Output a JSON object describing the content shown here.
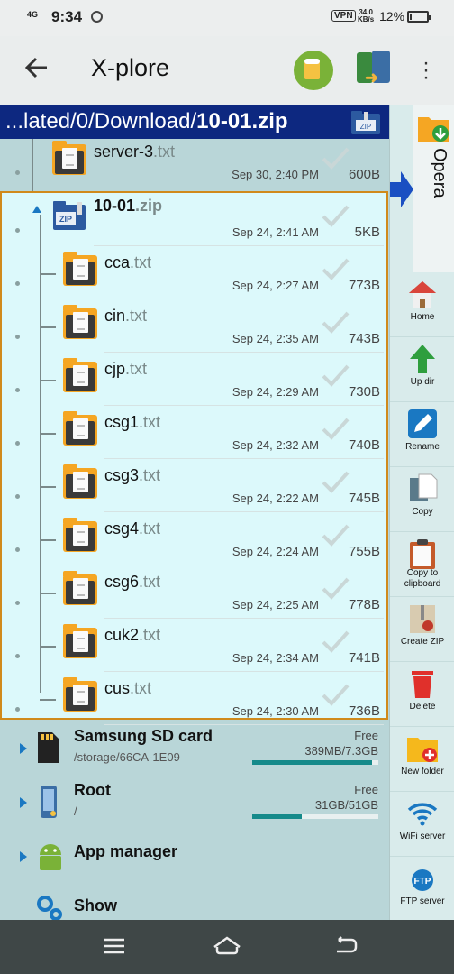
{
  "status_bar": {
    "network": "4G",
    "time": "9:34",
    "vpn": "VPN",
    "speed_value": "34.0",
    "speed_unit": "KB/s",
    "battery": "12%",
    "battery_level": 0.12
  },
  "app_bar": {
    "title": "X-plore"
  },
  "path_bar": {
    "prefix": "...lated/0/Download/",
    "current": "10-01.zip",
    "icon_label": "ZIP"
  },
  "files_before": [
    {
      "name": "server-3",
      "ext": ".txt",
      "date": "Sep 30, 2:40 PM",
      "size": "600B"
    }
  ],
  "zip_entry": {
    "name": "10-01",
    "ext": ".zip",
    "date": "Sep 24, 2:41 AM",
    "size": "5KB",
    "icon_label": "ZIP"
  },
  "zip_files": [
    {
      "name": "cca",
      "ext": ".txt",
      "date": "Sep 24, 2:27 AM",
      "size": "773B"
    },
    {
      "name": "cin",
      "ext": ".txt",
      "date": "Sep 24, 2:35 AM",
      "size": "743B"
    },
    {
      "name": "cjp",
      "ext": ".txt",
      "date": "Sep 24, 2:29 AM",
      "size": "730B"
    },
    {
      "name": "csg1",
      "ext": ".txt",
      "date": "Sep 24, 2:32 AM",
      "size": "740B"
    },
    {
      "name": "csg3",
      "ext": ".txt",
      "date": "Sep 24, 2:22 AM",
      "size": "745B"
    },
    {
      "name": "csg4",
      "ext": ".txt",
      "date": "Sep 24, 2:24 AM",
      "size": "755B"
    },
    {
      "name": "csg6",
      "ext": ".txt",
      "date": "Sep 24, 2:25 AM",
      "size": "778B"
    },
    {
      "name": "cuk2",
      "ext": ".txt",
      "date": "Sep 24, 2:34 AM",
      "size": "741B"
    },
    {
      "name": "cus",
      "ext": ".txt",
      "date": "Sep 24, 2:30 AM",
      "size": "736B"
    }
  ],
  "volumes": [
    {
      "name": "Samsung SD card",
      "path": "/storage/66CA-1E09",
      "free_label": "Free",
      "size": "389MB/7.3GB",
      "fill": 0.95,
      "icon": "sd-card-icon"
    },
    {
      "name": "Root",
      "path": "/",
      "free_label": "Free",
      "size": "31GB/51GB",
      "fill": 0.39,
      "icon": "phone-storage-icon"
    },
    {
      "name": "App manager",
      "icon": "android-icon"
    },
    {
      "name": "Show",
      "icon": "show-icon"
    }
  ],
  "toolbar": {
    "opera_label": "Opera",
    "items": [
      {
        "label": "Home",
        "icon": "home-icon"
      },
      {
        "label": "Up dir",
        "icon": "up-arrow-icon"
      },
      {
        "label": "Rename",
        "icon": "rename-icon"
      },
      {
        "label": "Copy",
        "icon": "copy-icon"
      },
      {
        "label": "Copy to clipboard",
        "icon": "clipboard-icon"
      },
      {
        "label": "Create ZIP",
        "icon": "create-zip-icon"
      },
      {
        "label": "Delete",
        "icon": "trash-icon"
      },
      {
        "label": "New folder",
        "icon": "new-folder-icon"
      },
      {
        "label": "WiFi server",
        "icon": "wifi-icon"
      },
      {
        "label": "FTP server",
        "icon": "ftp-icon"
      }
    ]
  },
  "colors": {
    "path_bar_bg": "#0d2880",
    "selection_border": "#d08a1b",
    "selection_bg": "#dcf9fb",
    "panel_bg": "#b9d6d8",
    "folder_orange": "#f5a623",
    "accent_blue": "#1a78c2"
  }
}
